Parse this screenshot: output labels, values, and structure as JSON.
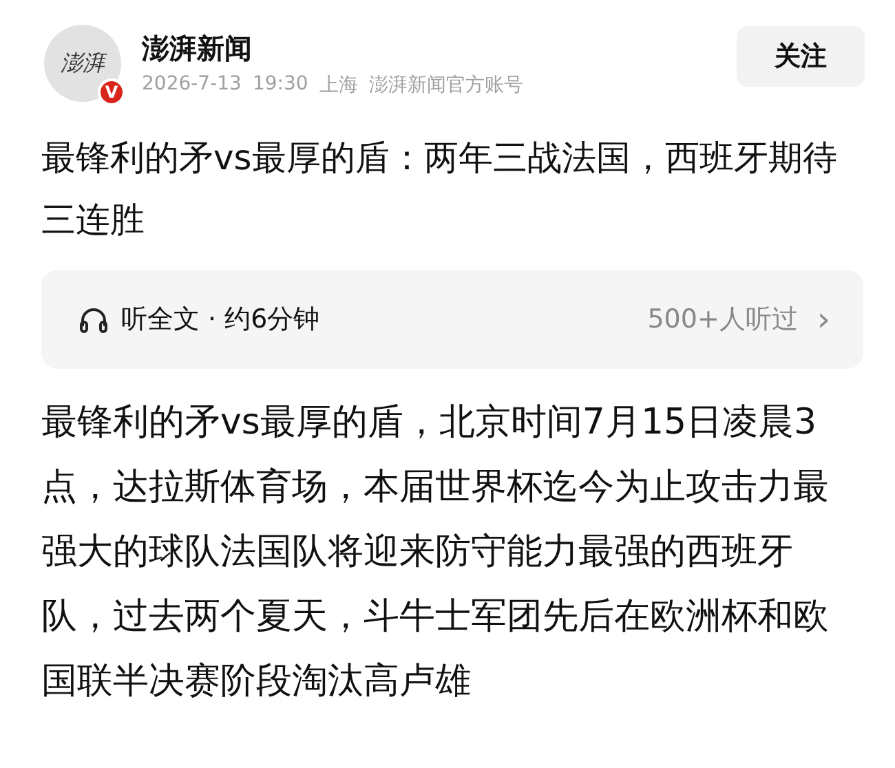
{
  "author": {
    "logo_text": "澎湃",
    "verified": true,
    "verified_mark": "V",
    "name": "澎湃新闻",
    "date": "2026-7-13",
    "time": "19:30",
    "location": "上海",
    "account_type": "澎湃新闻官方账号"
  },
  "follow_button": {
    "label": "关注"
  },
  "title": "最锋利的矛vs最厚的盾：两年三战法国，西班牙期待三连胜",
  "audio": {
    "label": "听全文 · 约6分钟",
    "listeners": "500+人听过",
    "chevron": "›"
  },
  "body": "最锋利的矛vs最厚的盾，北京时间7月15日凌晨3点，达拉斯体育场，本届世界杯迄今为止攻击力最强大的球队法国队将迎来防守能力最强的西班牙队，过去两个夏天，斗牛士军团先后在欧洲杯和欧国联半决赛阶段淘汰高卢雄"
}
